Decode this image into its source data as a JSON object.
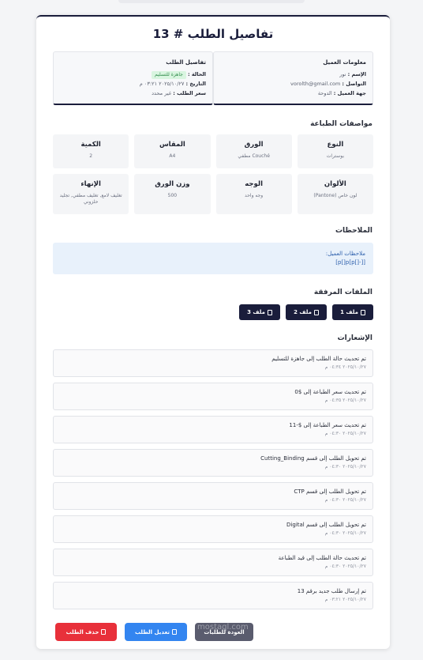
{
  "page": {
    "title": "تفاصيل الطلب # 13"
  },
  "customer": {
    "title": "معلومات العميل",
    "name_label": "الإسم :",
    "name": "نور",
    "contact_label": "التواصل :",
    "contact": "vorolth@gmail.com",
    "entity_label": "جهة العميل :",
    "entity": "الدوحة"
  },
  "order": {
    "title": "تفاصيل الطلب",
    "status_label": "الحالة :",
    "status": "جاهزة للتسليم",
    "status_color": "#2f8a4a",
    "date_label": "التاريخ :",
    "date": "٢٠٢٥/١٠/٢٧ ٠٣:٢١ م",
    "price_label": "سعر الطلب :",
    "price": "غير محدد"
  },
  "specs": {
    "title": "مواصفات الطباعة",
    "items": [
      {
        "label": "النوع",
        "value": "بوسترات"
      },
      {
        "label": "الورق",
        "value": "Couché مطفي"
      },
      {
        "label": "المقاس",
        "value": "A4"
      },
      {
        "label": "الكمية",
        "value": "2"
      },
      {
        "label": "الألوان",
        "value": "لون خاص (Pantone)"
      },
      {
        "label": "الوجه",
        "value": "وجه واحد"
      },
      {
        "label": "وزن الورق",
        "value": "500"
      },
      {
        "label": "الإنهاء",
        "value": "تغليف لامع, تغليف مطفي, تجليد حلزوني"
      }
    ]
  },
  "notes": {
    "title": "الملاحظات",
    "label": "ملاحظات العميل:",
    "text": "[[-[]p]p[]p]"
  },
  "files": {
    "title": "الملفات المرفقة",
    "items": [
      "ملف 1",
      "ملف 2",
      "ملف 3"
    ]
  },
  "notifications": {
    "title": "الإشعارات",
    "items": [
      {
        "text": "تم تحديث حالة الطلب إلى جاهزة للتسليم",
        "time": "٢٠٢٥/١٠/٢٧ ٠٤:٣٤ م"
      },
      {
        "text": "تم تحديث سعر الطباعة إلى $0",
        "time": "٢٠٢٥/١٠/٢٧ ٠٤:٣٥ م"
      },
      {
        "text": "تم تحديث سعر الطباعة إلى $-11",
        "time": "٢٠٢٥/١٠/٢٧ ٠٤:٣٠ م"
      },
      {
        "text": "تم تحويل الطلب إلى قسم Cutting_Binding",
        "time": "٢٠٢٥/١٠/٢٧ ٠٤:٣٠ م"
      },
      {
        "text": "تم تحويل الطلب إلى قسم CTP",
        "time": "٢٠٢٥/١٠/٢٧ ٠٤:٣٠ م"
      },
      {
        "text": "تم تحويل الطلب إلى قسم Digital",
        "time": "٢٠٢٥/١٠/٢٧ ٠٤:٣٠ م"
      },
      {
        "text": "تم تحديث حالة الطلب إلى قيد الطباعة",
        "time": "٢٠٢٥/١٠/٢٧ ٠٤:٣٠ م"
      },
      {
        "text": "تم إرسال طلب جديد برقم 13",
        "time": "٢٠٢٥/١٠/٢٧ ٠٣:٢١ م"
      }
    ]
  },
  "actions": {
    "delete": "حذف الطلب",
    "edit": "تعديل الطلب",
    "back": "العودة للطلبات"
  },
  "watermark": "mostaql.com"
}
